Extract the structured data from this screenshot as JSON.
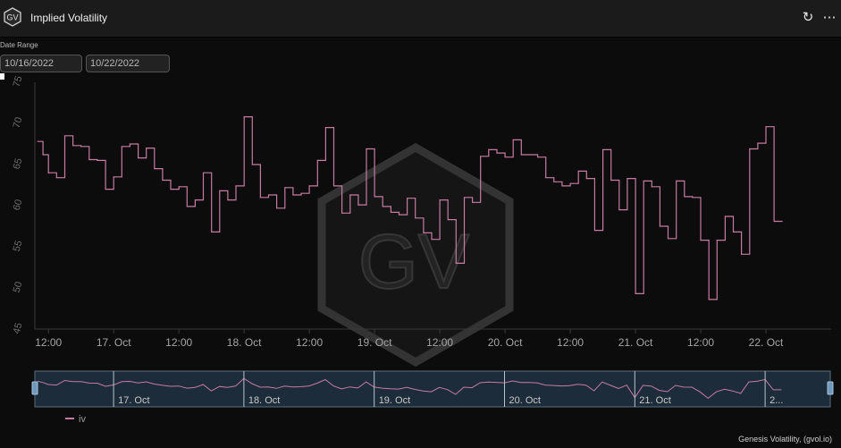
{
  "header": {
    "title": "Implied Volatility",
    "logo_text": "GV",
    "refresh_icon": "refresh-icon",
    "menu_icon": "ellipsis-icon"
  },
  "date_range": {
    "label": "Date Range",
    "start": "10/16/2022",
    "end": "10/22/2022"
  },
  "watermark": {
    "text": "GV"
  },
  "footer": {
    "credit": "Genesis Volatility, (gvol.io)"
  },
  "colors": {
    "series": "#c77ba2",
    "background": "#0c0c0c",
    "navigator_fill": "#1c2c3a"
  },
  "chart_data": {
    "type": "line",
    "title": "",
    "xlabel": "",
    "ylabel": "",
    "ylim": [
      45,
      75
    ],
    "y_ticks": [
      45,
      50,
      55,
      60,
      65,
      70,
      75
    ],
    "xlim": [
      "2022-10-16T09:30",
      "2022-10-22T12:00"
    ],
    "x_ticks": [
      {
        "t": "2022-10-16T12:00",
        "label": "12:00"
      },
      {
        "t": "2022-10-17T00:00",
        "label": "17. Oct"
      },
      {
        "t": "2022-10-17T12:00",
        "label": "12:00"
      },
      {
        "t": "2022-10-18T00:00",
        "label": "18. Oct"
      },
      {
        "t": "2022-10-18T12:00",
        "label": "12:00"
      },
      {
        "t": "2022-10-19T00:00",
        "label": "19. Oct"
      },
      {
        "t": "2022-10-19T12:00",
        "label": "12:00"
      },
      {
        "t": "2022-10-20T00:00",
        "label": "20. Oct"
      },
      {
        "t": "2022-10-20T12:00",
        "label": "12:00"
      },
      {
        "t": "2022-10-21T00:00",
        "label": "21. Oct"
      },
      {
        "t": "2022-10-21T12:00",
        "label": "12:00"
      },
      {
        "t": "2022-10-22T00:00",
        "label": "22. Oct"
      }
    ],
    "navigator_ticks": [
      "17. Oct",
      "18. Oct",
      "19. Oct",
      "20. Oct",
      "21. Oct",
      "2..."
    ],
    "grid": false,
    "legend": "bottom-left",
    "series": [
      {
        "name": "iv",
        "x": [
          "2022-10-16T10:00",
          "2022-10-16T11:00",
          "2022-10-16T12:00",
          "2022-10-16T13:30",
          "2022-10-16T15:00",
          "2022-10-16T16:30",
          "2022-10-16T18:00",
          "2022-10-16T19:30",
          "2022-10-16T21:00",
          "2022-10-16T22:30",
          "2022-10-17T00:00",
          "2022-10-17T01:30",
          "2022-10-17T03:00",
          "2022-10-17T04:30",
          "2022-10-17T06:00",
          "2022-10-17T07:30",
          "2022-10-17T09:00",
          "2022-10-17T10:30",
          "2022-10-17T12:00",
          "2022-10-17T13:30",
          "2022-10-17T15:00",
          "2022-10-17T16:30",
          "2022-10-17T18:00",
          "2022-10-17T19:30",
          "2022-10-17T21:00",
          "2022-10-17T22:30",
          "2022-10-18T00:00",
          "2022-10-18T01:30",
          "2022-10-18T03:00",
          "2022-10-18T04:30",
          "2022-10-18T06:00",
          "2022-10-18T07:30",
          "2022-10-18T09:00",
          "2022-10-18T10:30",
          "2022-10-18T12:00",
          "2022-10-18T13:30",
          "2022-10-18T15:00",
          "2022-10-18T16:30",
          "2022-10-18T18:00",
          "2022-10-18T19:30",
          "2022-10-18T21:00",
          "2022-10-18T22:30",
          "2022-10-19T00:00",
          "2022-10-19T01:30",
          "2022-10-19T03:00",
          "2022-10-19T04:30",
          "2022-10-19T06:00",
          "2022-10-19T07:30",
          "2022-10-19T09:00",
          "2022-10-19T10:30",
          "2022-10-19T12:00",
          "2022-10-19T13:30",
          "2022-10-19T15:00",
          "2022-10-19T16:30",
          "2022-10-19T18:00",
          "2022-10-19T19:30",
          "2022-10-19T21:00",
          "2022-10-19T22:30",
          "2022-10-20T00:00",
          "2022-10-20T01:30",
          "2022-10-20T03:00",
          "2022-10-20T04:30",
          "2022-10-20T06:00",
          "2022-10-20T07:30",
          "2022-10-20T09:00",
          "2022-10-20T10:30",
          "2022-10-20T12:00",
          "2022-10-20T13:30",
          "2022-10-20T15:00",
          "2022-10-20T16:30",
          "2022-10-20T18:00",
          "2022-10-20T19:30",
          "2022-10-20T21:00",
          "2022-10-20T22:30",
          "2022-10-21T00:00",
          "2022-10-21T01:30",
          "2022-10-21T03:00",
          "2022-10-21T04:30",
          "2022-10-21T06:00",
          "2022-10-21T07:30",
          "2022-10-21T09:00",
          "2022-10-21T10:30",
          "2022-10-21T12:00",
          "2022-10-21T13:30",
          "2022-10-21T15:00",
          "2022-10-21T16:30",
          "2022-10-21T18:00",
          "2022-10-21T19:30",
          "2022-10-21T21:00",
          "2022-10-21T22:30",
          "2022-10-22T00:00",
          "2022-10-22T01:30",
          "2022-10-22T03:00"
        ],
        "values": [
          67.8,
          66.2,
          64.0,
          63.4,
          68.5,
          67.3,
          67.2,
          65.6,
          65.5,
          62.0,
          63.5,
          67.2,
          67.5,
          65.8,
          67.0,
          64.5,
          63.1,
          62.0,
          62.3,
          59.9,
          60.7,
          64.0,
          56.8,
          61.8,
          60.7,
          62.4,
          70.8,
          65.0,
          61.0,
          61.3,
          59.7,
          62.2,
          61.3,
          61.5,
          62.4,
          65.5,
          69.5,
          62.4,
          59.1,
          61.3,
          60.1,
          66.9,
          61.1,
          59.9,
          59.2,
          58.9,
          60.9,
          58.5,
          56.7,
          55.9,
          60.7,
          58.3,
          53.0,
          61.0,
          60.4,
          66.0,
          66.8,
          66.4,
          65.9,
          68.0,
          66.2,
          66.2,
          65.9,
          63.4,
          62.9,
          62.4,
          62.7,
          64.2,
          63.3,
          57.0,
          66.8,
          63.1,
          59.5,
          63.3,
          49.3,
          63.0,
          62.3,
          57.5,
          56.0,
          63.0,
          61.1,
          61.0,
          55.8,
          48.6,
          55.8,
          58.7,
          56.8,
          54.1,
          66.9,
          67.6,
          69.6,
          58.1,
          58.1
        ],
        "color": "#c77ba2"
      }
    ]
  }
}
